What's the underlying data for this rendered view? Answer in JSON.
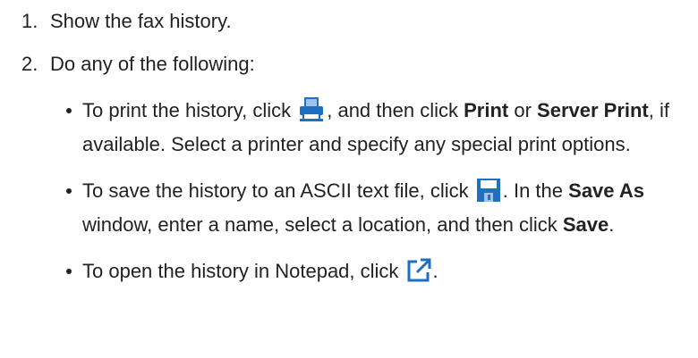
{
  "steps": [
    {
      "number": "1.",
      "text": "Show the fax history."
    },
    {
      "number": "2.",
      "text": "Do any of the following:"
    }
  ],
  "bullets": {
    "print": {
      "t1": "To print the history, click ",
      "icon": "print-icon",
      "t2": ", and then click ",
      "b1": "Print",
      "t3": " or ",
      "b2": "Server Print",
      "t4": ", if available. Select a printer and specify any special print options."
    },
    "save": {
      "t1": "To save the history to an ASCII text file, click ",
      "icon": "save-icon",
      "t2": ". In the ",
      "b1": "Save As",
      "t3": " window, enter a name, select a location, and then click ",
      "b2": "Save",
      "t4": "."
    },
    "open": {
      "t1": "To open the history in Notepad, click ",
      "icon": "open-external-icon",
      "t2": "."
    }
  },
  "colors": {
    "icon_blue": "#1f6fc2",
    "icon_light": "#9fc4ea",
    "text": "#222222"
  }
}
